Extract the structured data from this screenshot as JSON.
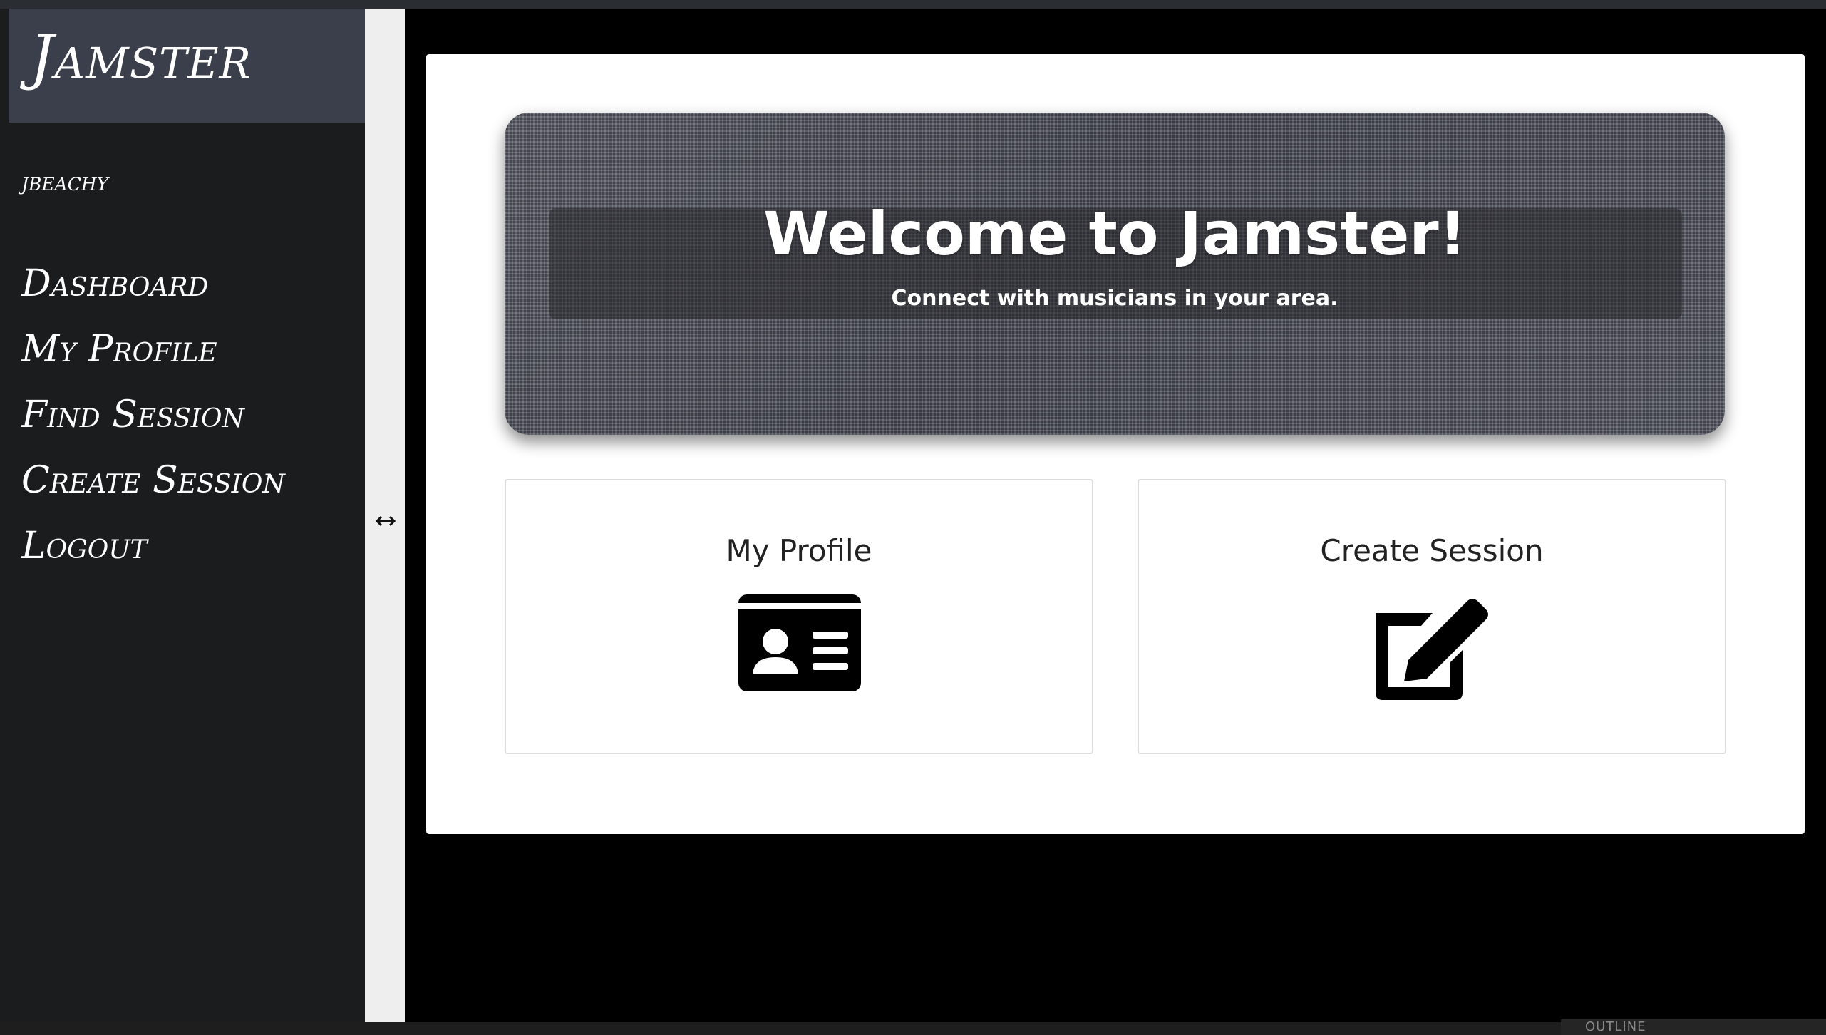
{
  "sidebar": {
    "brand": "Jamster",
    "username": "jbeachy",
    "nav": [
      {
        "label": "Dashboard"
      },
      {
        "label": "My Profile"
      },
      {
        "label": "Find Session"
      },
      {
        "label": "Create Session"
      },
      {
        "label": "Logout"
      }
    ]
  },
  "hero": {
    "title": "Welcome to Jamster!",
    "subtitle": "Connect with musicians in your area."
  },
  "cards": [
    {
      "title": "My Profile",
      "icon": "id-card-icon"
    },
    {
      "title": "Create Session",
      "icon": "edit-icon"
    }
  ],
  "statusbar": {
    "outline_label": "OUTLINE"
  },
  "colors": {
    "sidebar_bg": "#1b1c1e",
    "brand_bg": "#3b3f4b",
    "content_bg": "#000000",
    "panel_bg": "#ffffff"
  }
}
